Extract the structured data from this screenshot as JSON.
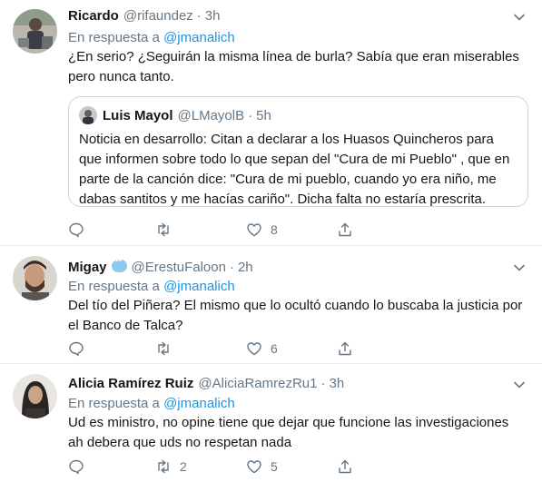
{
  "tweets": [
    {
      "name": "Ricardo",
      "handle": "@rifaundez",
      "time": "3h",
      "reply_prefix": "En respuesta a",
      "reply_to": "@jmanalich",
      "text": "¿En serio? ¿Seguirán la misma línea de burla? Sabía que eran miserables pero nunca tanto.",
      "quote": {
        "name": "Luis Mayol",
        "handle": "@LMayolB",
        "time": "5h",
        "text": "Noticia en desarrollo:  Citan a declarar a los Huasos Quincheros para que informen sobre todo lo que sepan del \"Cura de mi Pueblo\" , que en parte de la canción dice: \"Cura de mi pueblo, cuando yo era niño, me dabas santitos y me hacías cariño\". Dicha falta no estaría prescrita."
      },
      "replies": "",
      "retweets": "",
      "likes": "8"
    },
    {
      "name": "Migay",
      "handle": "@ErestuFaloon",
      "time": "2h",
      "reply_prefix": "En respuesta a",
      "reply_to": "@jmanalich",
      "text": "Del tío del Piñera? El mismo que lo ocultó cuando lo buscaba la justicia por el Banco de Talca?",
      "replies": "",
      "retweets": "",
      "likes": "6"
    },
    {
      "name": "Alicia Ramírez Ruiz",
      "handle": "@AliciaRamrezRu1",
      "time": "3h",
      "reply_prefix": "En respuesta a",
      "reply_to": "@jmanalich",
      "text": "Ud es ministro, no opine tiene que dejar que funcione las investigaciones ah debera que uds no respetan nada",
      "replies": "",
      "retweets": "2",
      "likes": "5"
    }
  ],
  "separator": "·",
  "colors": {
    "text": "#14171a",
    "secondary": "#657786",
    "link": "#1b95e0",
    "border": "#e6ecf0"
  },
  "icons": [
    "chevron-down-icon",
    "reply-icon",
    "retweet-icon",
    "like-icon",
    "share-icon",
    "speech-bubble-emoji-icon"
  ]
}
